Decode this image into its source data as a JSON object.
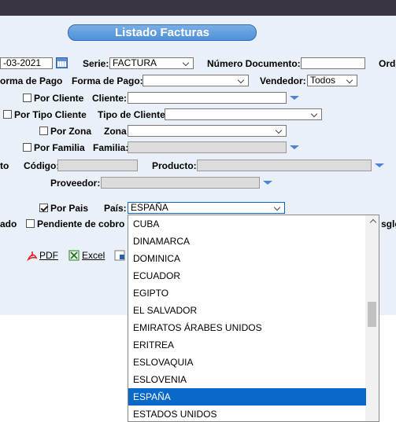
{
  "title": "Listado Facturas",
  "row1": {
    "date_value": "-03-2021",
    "serie_label": "Serie:",
    "serie_value": "FACTURA",
    "num_doc_label": "Número Documento:",
    "num_doc_value": "",
    "orden_label": "Ord"
  },
  "row2": {
    "forma_pago_check_label": "orma de Pago",
    "forma_pago_label": "Forma de Pago:",
    "forma_pago_value": "",
    "vendedor_label": "Vendedor:",
    "vendedor_value": "Todos"
  },
  "row3": {
    "por_cliente_label": "Por Cliente",
    "cliente_label": "Cliente:",
    "cliente_value": ""
  },
  "row4": {
    "por_tipo_cliente_label": "Por Tipo Cliente",
    "tipo_cliente_label": "Tipo de Cliente",
    "tipo_cliente_value": ""
  },
  "row5": {
    "por_zona_label": "Por Zona",
    "zona_label": "Zona",
    "zona_value": ""
  },
  "row6": {
    "por_familia_label": "Por Familia",
    "familia_label": "Familia:",
    "familia_value": ""
  },
  "row7": {
    "prefix_label": "to",
    "codigo_label": "Código:",
    "codigo_value": "",
    "producto_label": "Producto:",
    "producto_value": ""
  },
  "row8": {
    "proveedor_label": "Proveedor:",
    "proveedor_value": ""
  },
  "row9": {
    "por_pais_label": "Por Pais",
    "pais_label": "País:",
    "pais_value": "ESPAÑA"
  },
  "row10": {
    "prefix_label": "ado",
    "pendiente_label": "Pendiente de cobro",
    "right_label": "sglo"
  },
  "exports": {
    "pdf_label": "PDF",
    "excel_label": "Excel"
  },
  "country_options": [
    "CUBA",
    "DINAMARCA",
    "DOMINICA",
    "ECUADOR",
    "EGIPTO",
    "EL SALVADOR",
    "EMIRATOS ÁRABES UNIDOS",
    "ERITREA",
    "ESLOVAQUIA",
    "ESLOVENIA",
    "ESPAÑA",
    "ESTADOS UNIDOS"
  ],
  "selected_country": "ESPAÑA",
  "colors": {
    "accent": "#4f8fd8",
    "selected": "#0a68c8",
    "panel": "#eaf0f8"
  }
}
